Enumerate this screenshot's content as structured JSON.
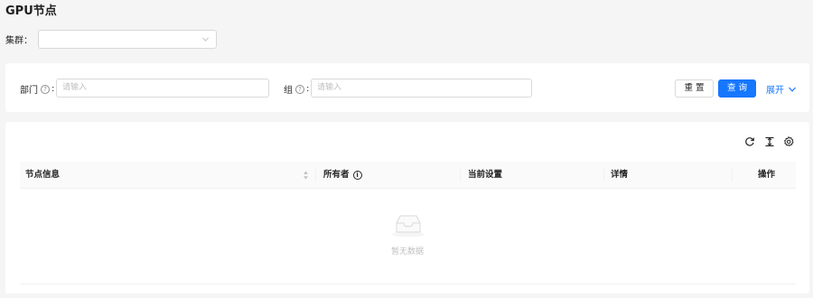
{
  "page": {
    "title": "GPU节点"
  },
  "cluster": {
    "label": "集群：",
    "value": ""
  },
  "filters": {
    "department_label": "部门",
    "department_placeholder": "请输入",
    "group_label": "组",
    "group_placeholder": "请输入",
    "colon": ":",
    "reset_label": "重 置",
    "query_label": "查 询",
    "expand_label": "展开"
  },
  "toolbar": {
    "icons": [
      "reload-icon",
      "column-height-icon",
      "setting-icon"
    ]
  },
  "table": {
    "columns": [
      "节点信息",
      "所有者",
      "当前设置",
      "详情",
      "操作"
    ],
    "empty_text": "暂无数据"
  },
  "colors": {
    "primary": "#1677ff",
    "background": "#f5f5f5",
    "border": "#d9d9d9"
  }
}
